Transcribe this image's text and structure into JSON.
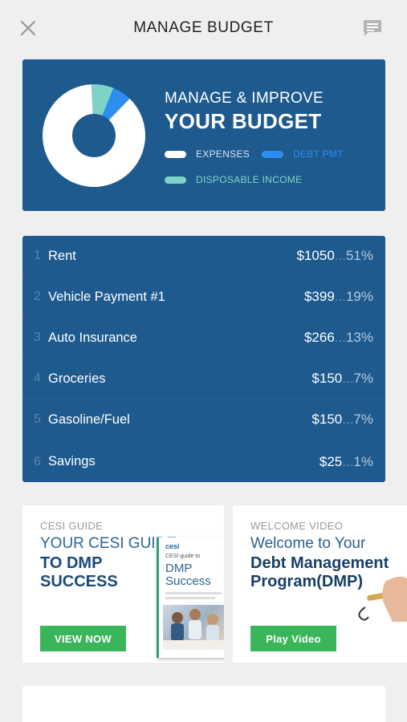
{
  "header": {
    "title": "MANAGE BUDGET",
    "close_icon": "close-icon",
    "chat_icon": "chat-icon"
  },
  "summary_card": {
    "heading_line1": "MANAGE & IMPROVE",
    "heading_line2": "YOUR BUDGET",
    "legend": [
      {
        "label": "EXPENSES",
        "color": "#ffffff"
      },
      {
        "label": "DEBT PMT",
        "color": "#2d8ef0"
      },
      {
        "label": "DISPOSABLE INCOME",
        "color": "#7fd3c6"
      }
    ],
    "donut_share": {
      "expenses": 0.87,
      "debt_pmt": 0.06,
      "disposable_income": 0.07
    }
  },
  "expenses": [
    {
      "num": "1",
      "name": "Rent",
      "amount": "$1050",
      "dots": "...",
      "pct": "51%"
    },
    {
      "num": "2",
      "name": "Vehicle Payment #1",
      "amount": "$399",
      "dots": "...",
      "pct": "19%"
    },
    {
      "num": "3",
      "name": "Auto Insurance",
      "amount": "$266",
      "dots": "...",
      "pct": "13%"
    },
    {
      "num": "4",
      "name": "Groceries",
      "amount": "$150",
      "dots": "...",
      "pct": "7%"
    },
    {
      "num": "5",
      "name": "Gasoline/Fuel",
      "amount": "$150",
      "dots": "...",
      "pct": "7%"
    },
    {
      "num": "6",
      "name": "Savings",
      "amount": "$25",
      "dots": "...",
      "pct": "1%"
    }
  ],
  "promos": [
    {
      "kicker": "CESI GUIDE",
      "line1": "YOUR CESI GUIDE",
      "line2a": "TO DMP",
      "line2b": "SUCCESS",
      "button": "VIEW NOW",
      "book": {
        "brand": "cesi",
        "small": "CESI guide to",
        "title1": "DMP",
        "title2": "Success"
      }
    },
    {
      "kicker": "WELCOME VIDEO",
      "line1": "Welcome to Your",
      "line2a": "Debt Management",
      "line2b": "Program(DMP)",
      "button": "Play Video"
    }
  ]
}
